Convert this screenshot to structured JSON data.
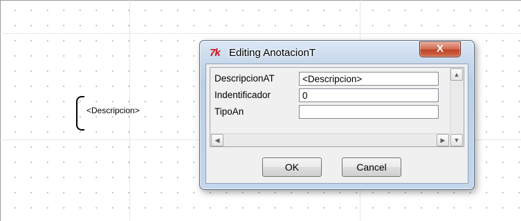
{
  "canvas": {
    "annotation_text": "<Descripcion>"
  },
  "dialog": {
    "title": "Editing AnotacionT",
    "app_icon_text": "7k",
    "close_glyph": "X",
    "fields": [
      {
        "label": "DescripcionAT",
        "value": "<Descripcion>"
      },
      {
        "label": "Indentificador",
        "value": "0"
      },
      {
        "label": "TipoAn",
        "value": ""
      }
    ],
    "ok_label": "OK",
    "cancel_label": "Cancel",
    "scroll_up_glyph": "▲",
    "scroll_down_glyph": "▼",
    "scroll_left_glyph": "◀",
    "scroll_right_glyph": "▶"
  },
  "colors": {
    "close_button": "#c8492f",
    "canvas_grid_dot": "#b8b8b8",
    "app_icon": "#d0141b"
  }
}
